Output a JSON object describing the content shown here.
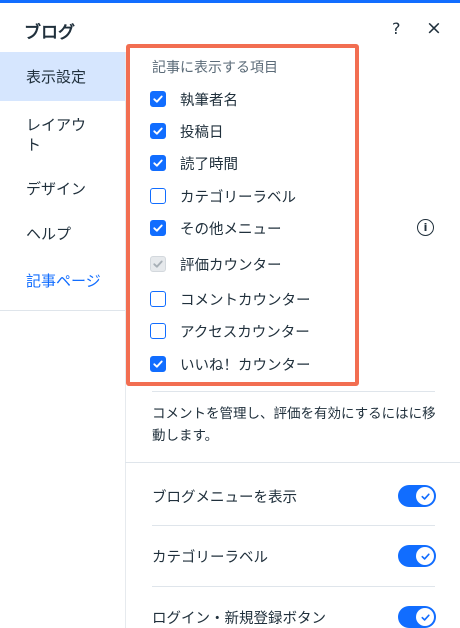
{
  "colors": {
    "accent": "#116dff",
    "highlight": "#f26e51",
    "active_nav_bg": "#d6e6fe"
  },
  "header": {
    "title": "ブログ",
    "help_icon": "?",
    "close_icon": "×"
  },
  "sidebar": {
    "items": [
      {
        "label": "表示設定"
      },
      {
        "label": "レイアウ\nト"
      },
      {
        "label": "デザイン"
      },
      {
        "label": "ヘルプ"
      },
      {
        "label": "記事ページ"
      }
    ]
  },
  "display_items": {
    "title": "記事に表示する項目",
    "items": [
      {
        "label": "執筆者名",
        "checked": true
      },
      {
        "label": "投稿日",
        "checked": true
      },
      {
        "label": "読了時間",
        "checked": true
      },
      {
        "label": "カテゴリーラベル",
        "checked": false
      },
      {
        "label": "その他メニュー",
        "checked": true
      },
      {
        "label": "評価カウンター",
        "checked": true,
        "disabled": true
      },
      {
        "label": "コメントカウンター",
        "checked": false
      },
      {
        "label": "アクセスカウンター",
        "checked": false
      },
      {
        "label": "いいね！カウンター",
        "checked": true
      }
    ],
    "info_icon": "i"
  },
  "note": "コメントを管理し、評価を有効にするにはに移動します。",
  "toggles": [
    {
      "label": "ブログメニューを表示",
      "on": true
    },
    {
      "label": "カテゴリーラベル",
      "on": true
    },
    {
      "label": "ログイン・新規登録ボタン",
      "on": true
    }
  ]
}
